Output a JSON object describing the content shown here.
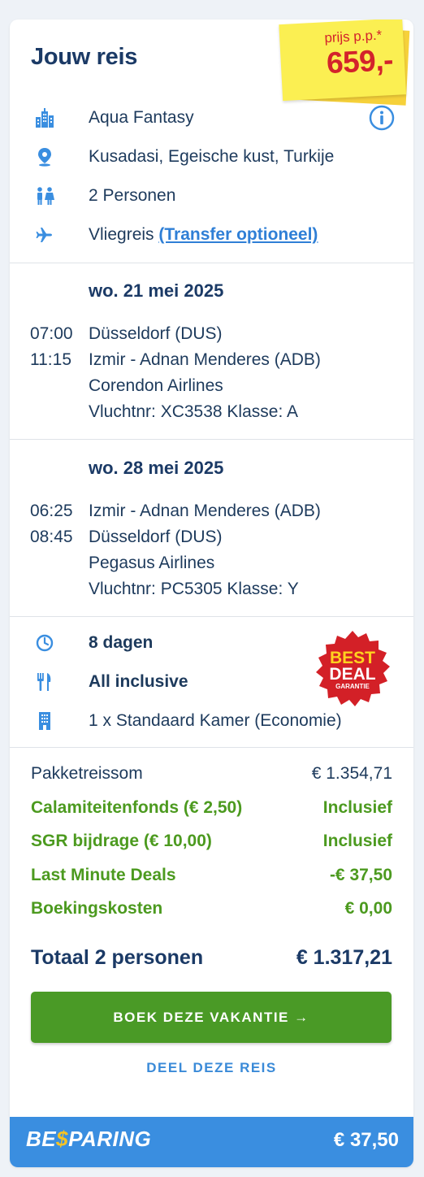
{
  "header": {
    "title": "Jouw reis",
    "price_label": "prijs p.p.*",
    "price": "659,-"
  },
  "trip": {
    "hotel": "Aqua Fantasy",
    "location": "Kusadasi, Egeische kust, Turkije",
    "persons": "2 Personen",
    "travel_prefix": "Vliegreis",
    "transfer_link": "(Transfer optioneel)"
  },
  "outbound": {
    "date": "wo. 21 mei 2025",
    "dep_time": "07:00",
    "dep_airport": "Düsseldorf (DUS)",
    "arr_time": "11:15",
    "arr_airport": "Izmir - Adnan Menderes (ADB)",
    "airline": "Corendon Airlines",
    "flight": "Vluchtnr: XC3538 Klasse: A"
  },
  "return": {
    "date": "wo. 28 mei 2025",
    "dep_time": "06:25",
    "dep_airport": "Izmir - Adnan Menderes (ADB)",
    "arr_time": "08:45",
    "arr_airport": "Düsseldorf (DUS)",
    "airline": "Pegasus Airlines",
    "flight": "Vluchtnr: PC5305 Klasse: Y"
  },
  "stay": {
    "duration": "8 dagen",
    "board": "All inclusive",
    "room": "1 x Standaard Kamer (Economie)",
    "badge_line1": "BEST",
    "badge_line2": "DEAL",
    "badge_line3": "GARANTIE"
  },
  "prices": [
    {
      "label": "Pakketreissom",
      "value": "€ 1.354,71"
    },
    {
      "label": "Calamiteitenfonds (€ 2,50)",
      "value": "Inclusief"
    },
    {
      "label": "SGR bijdrage (€ 10,00)",
      "value": "Inclusief"
    },
    {
      "label": "Last Minute Deals",
      "value": "-€ 37,50"
    },
    {
      "label": "Boekingskosten",
      "value": "€ 0,00"
    }
  ],
  "total": {
    "label": "Totaal 2 personen",
    "value": "€ 1.317,21"
  },
  "actions": {
    "book": "BOEK DEZE VAKANTIE →",
    "share": "DEEL DEZE REIS"
  },
  "footer": {
    "brand_a": "BE",
    "brand_dollar": "$",
    "brand_b": "PARING",
    "amount": "€ 37,50"
  },
  "colors": {
    "navy": "#1b3a66",
    "green": "#4c9a1f",
    "blue": "#3a8ee0",
    "red": "#d3232b",
    "yellow": "#fbef52"
  }
}
